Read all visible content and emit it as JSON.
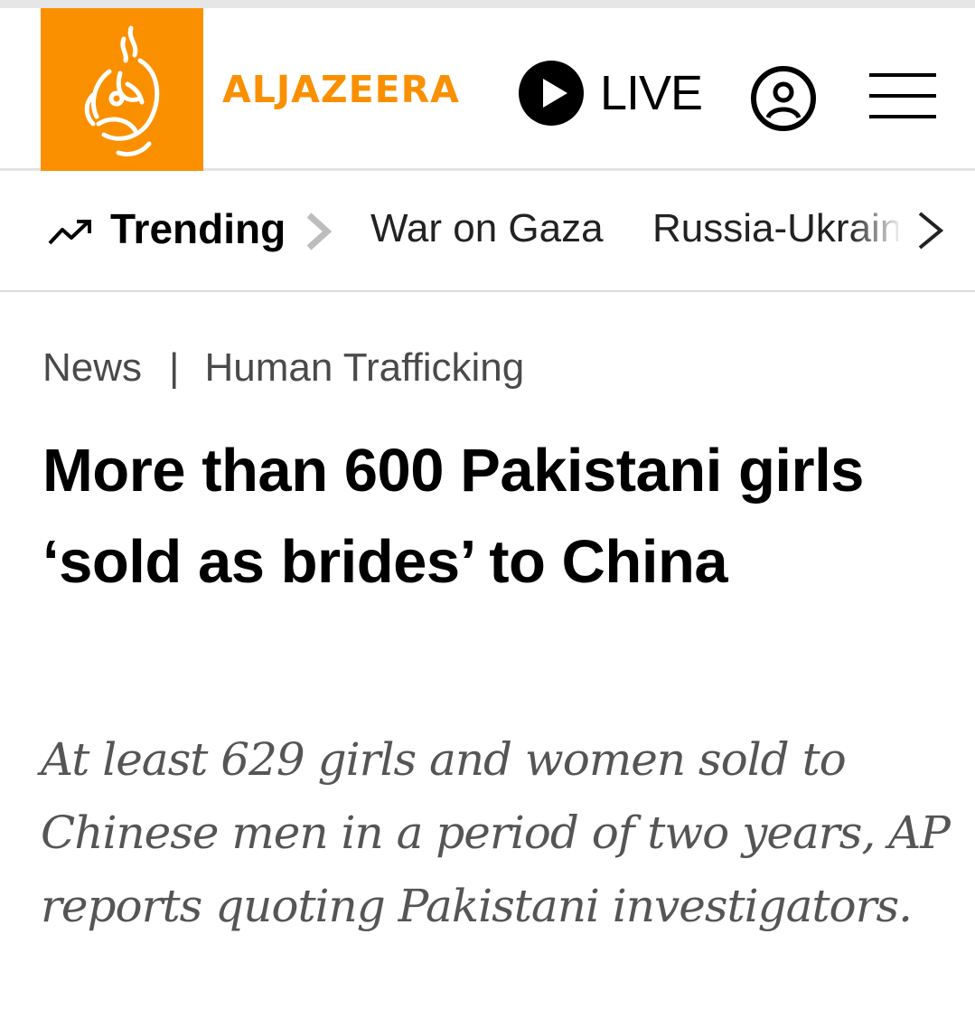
{
  "header": {
    "brand": "ALJAZEERA",
    "live_label": "LIVE",
    "brand_color": "#fa9000"
  },
  "trending": {
    "label": "Trending",
    "items": [
      "War on Gaza",
      "Russia-Ukraine"
    ]
  },
  "article": {
    "breadcrumb": [
      "News",
      "Human Trafficking"
    ],
    "breadcrumb_separator": "|",
    "headline": "More than 600 Pakistani girls ‘sold as brides’ to China",
    "standfirst": "At least 629 girls and women sold to Chinese men in a period of two years, AP reports quoting Pakistani investigators."
  },
  "icons": [
    "aljazeera-logo-icon",
    "play-icon",
    "account-icon",
    "hamburger-menu-icon",
    "trending-arrow-icon",
    "chevron-right-icon"
  ]
}
